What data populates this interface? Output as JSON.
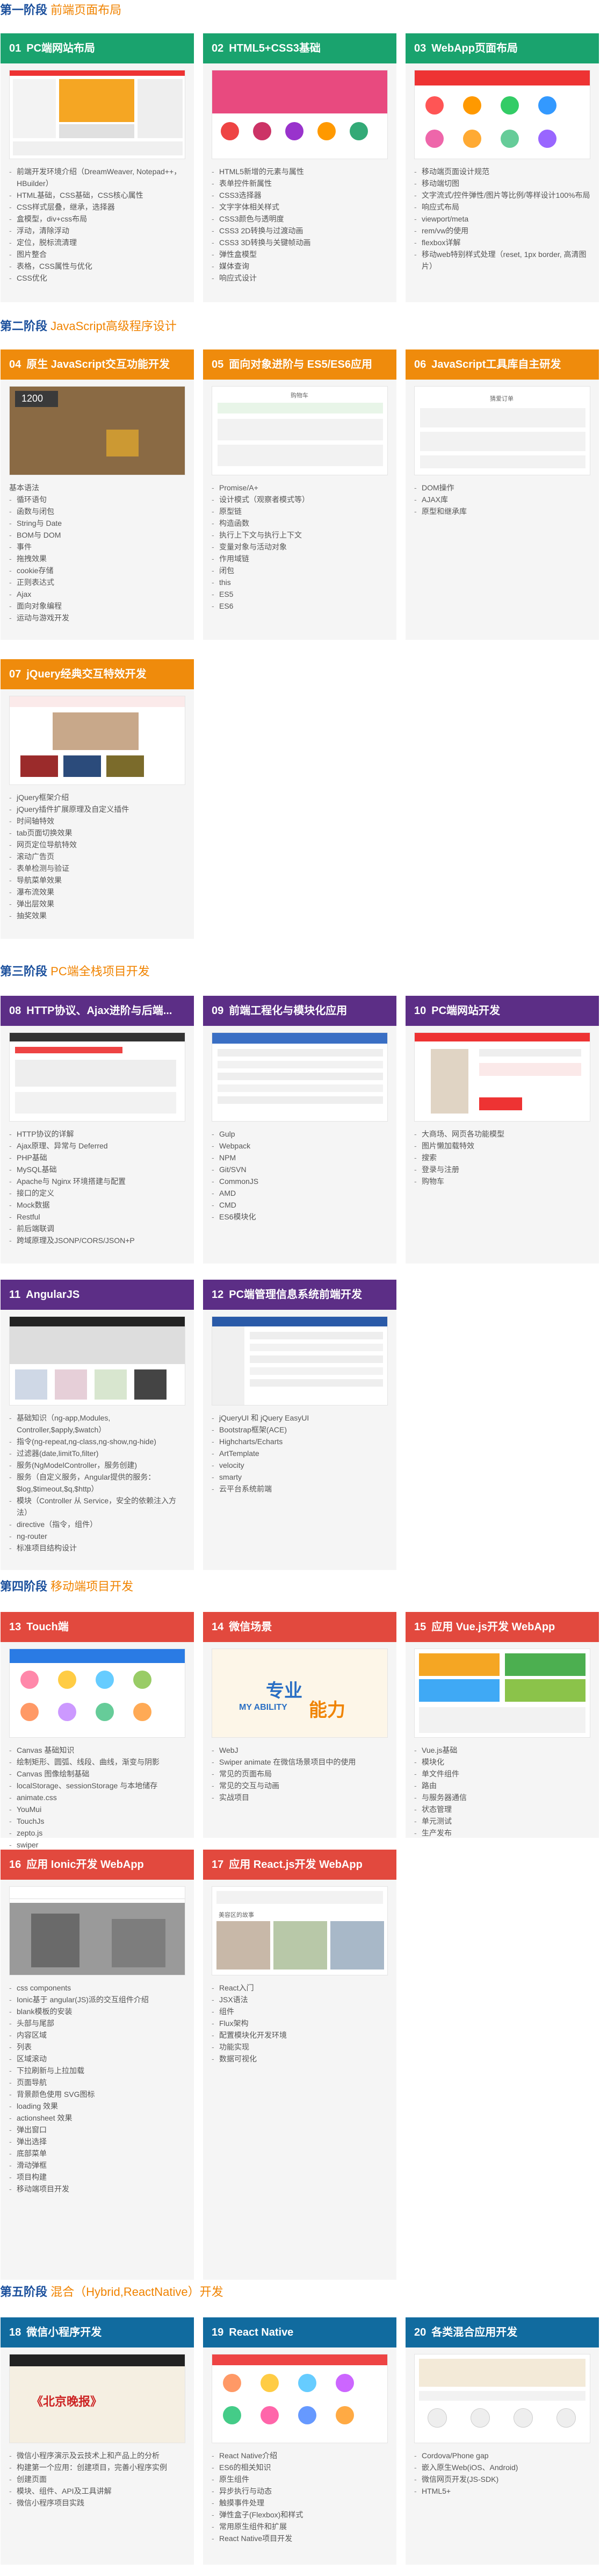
{
  "stages": [
    {
      "bold": "第一阶段",
      "sub": "前端页面布局"
    },
    {
      "bold": "第二阶段",
      "sub": "JavaScript高级程序设计"
    },
    {
      "bold": "第三阶段",
      "sub": "PC端全栈项目开发"
    },
    {
      "bold": "第四阶段",
      "sub": "移动端项目开发"
    },
    {
      "bold": "第五阶段",
      "sub": "混合（Hybrid,ReactNative）开发"
    }
  ],
  "cards": [
    {
      "num": "01",
      "title": "PC端网站布局",
      "items": [
        "前端开发环境介绍（DreamWeaver, Notepad++，HBuilder）",
        "HTML基础，CSS基础，CSS核心属性",
        "CSS样式层叠，继承，选择器",
        "盒模型，div+css布局",
        "浮动，清除浮动",
        "定位，脱标流清理",
        "图片整合",
        "表格，CSS属性与优化",
        "CSS优化"
      ]
    },
    {
      "num": "02",
      "title": "HTML5+CSS3基础",
      "items": [
        "HTML5新增的元素与属性",
        "表单控件新属性",
        "CSS3选择器",
        "文字字体相关样式",
        "CSS3颜色与透明度",
        "CSS3 2D转换与过渡动画",
        "CSS3 3D转换与关键帧动画",
        "弹性盒模型",
        "媒体查询",
        "响应式设计"
      ]
    },
    {
      "num": "03",
      "title": "WebApp页面布局",
      "items": [
        "移动端页面设计规范",
        "移动端切图",
        "文字流式/控件弹性/图片等比例/等样设计100%布局",
        "响应式布局",
        "viewport/meta",
        "rem/vw的使用",
        "flexbox详解",
        "移动web特别样式处理（reset, 1px border, 高清图片）"
      ]
    },
    {
      "num": "04",
      "title": "原生 JavaScript交互功能开发",
      "items": [
        "基本语法",
        "循环语句",
        "函数与闭包",
        "String与 Date",
        "BOM与 DOM",
        "事件",
        "拖拽效果",
        "cookie存储",
        "正则表达式",
        "Ajax",
        "面向对象编程",
        "运动与游戏开发"
      ]
    },
    {
      "num": "05",
      "title": "面向对象进阶与 ES5/ES6应用",
      "items": [
        "Promise/A+",
        "设计模式（观察者模式等）",
        "原型链",
        "构造函数",
        "执行上下文与执行上下文",
        "变量对象与活动对象",
        "作用域链",
        "闭包",
        "this",
        "ES5",
        "ES6"
      ]
    },
    {
      "num": "06",
      "title": "JavaScript工具库自主研发",
      "items": [
        "DOM操作",
        "AJAX库",
        "原型和继承库"
      ]
    },
    {
      "num": "07",
      "title": "jQuery经典交互特效开发",
      "items": [
        "jQuery框架介绍",
        "jQuery插件扩展原理及自定义插件",
        "时间轴特效",
        "tab页面切换效果",
        "网页定位导航特效",
        "滚动广告页",
        "表单检测与验证",
        "导航菜单效果",
        "瀑布流效果",
        "弹出层效果",
        "抽奖效果"
      ]
    },
    {
      "num": "08",
      "title": "HTTP协议、Ajax进阶与后端...",
      "items": [
        "HTTP协议的详解",
        "Ajax原理、异常与 Deferred",
        "PHP基础",
        "MySQL基础",
        "Apache与 Nginx 环境搭建与配置",
        "接口的定义",
        "Mock数据",
        "Restful",
        "前后端联调",
        "跨域原理及JSONP/CORS/JSON+P"
      ]
    },
    {
      "num": "09",
      "title": "前端工程化与模块化应用",
      "items": [
        "Gulp",
        "Webpack",
        "NPM",
        "Git/SVN",
        "CommonJS",
        "AMD",
        "CMD",
        "ES6模块化"
      ]
    },
    {
      "num": "10",
      "title": "PC端网站开发",
      "items": [
        "大商场、网页各功能模型",
        "图片懒加载特效",
        "搜索",
        "登录与注册",
        "购物车"
      ]
    },
    {
      "num": "11",
      "title": "AngularJS",
      "items": [
        "基础知识（ng-app,Modules, Controller,$apply,$watch）",
        "指令(ng-repeat,ng-class,ng-show,ng-hide)",
        "过滤器(date,limitTo,filter)",
        "服务(NgModelController，服务创建)",
        "服务（自定义服务，Angular提供的服务：$log,$timeout,$q,$http）",
        "模块（Controller 从 Service，安全的依赖注入方法）",
        "directive（指令，组件）",
        "ng-router",
        "标准项目结构设计"
      ]
    },
    {
      "num": "12",
      "title": "PC端管理信息系统前端开发",
      "items": [
        "jQueryUI 和 jQuery EasyUI",
        "Bootstrap框架(ACE)",
        "Highcharts/Echarts",
        "ArtTemplate",
        "velocity",
        "smarty",
        "云平台系统前端"
      ]
    },
    {
      "num": "13",
      "title": "Touch端",
      "items": [
        "Canvas 基础知识",
        "绘制矩形、圆弧、线段、曲线，渐变与阴影",
        "Canvas 图像绘制基础",
        "localStorage、sessionStorage 与本地储存",
        "animate.css",
        "YouMui",
        "TouchJs",
        "zepto.js",
        "swiper",
        "iScroll"
      ]
    },
    {
      "num": "14",
      "title": "微信场景",
      "items": [
        "WebJ",
        "Swiper animate 在微信场景项目中的使用",
        "常见的页面布局",
        "常见的交互与动画",
        "实战项目"
      ]
    },
    {
      "num": "15",
      "title": "应用 Vue.js开发 WebApp",
      "items": [
        "Vue.js基础",
        "模块化",
        "单文件组件",
        "路由",
        "与服务器通信",
        "状态管理",
        "单元测试",
        "生产发布"
      ]
    },
    {
      "num": "16",
      "title": "应用 Ionic开发 WebApp",
      "items": [
        "css components",
        "Ionic基于 angular(JS)派的交互组件介绍",
        "blank模板的安装",
        "头部与尾部",
        "内容区域",
        "列表",
        "区域滚动",
        "下拉刷新与上拉加载",
        "页面导航",
        "背景颜色使用 SVG图标",
        "loading 效果",
        "actionsheet 效果",
        "弹出窗口",
        "弹出选择",
        "底部菜单",
        "滑动弹框",
        "项目构建",
        "移动端项目开发"
      ]
    },
    {
      "num": "17",
      "title": "应用 React.js开发 WebApp",
      "items": [
        "React入门",
        "JSX语法",
        "组件",
        "Flux架构",
        "配置模块化开发环境",
        "功能实现",
        "数据可视化"
      ]
    },
    {
      "num": "18",
      "title": "微信小程序开发",
      "items": [
        "微信小程序演示及云技术上和产品上的分析",
        "构建第一个应用：创建项目，完善小程序实例",
        "创建页面",
        "模块、组件、API及工具讲解",
        "微信小程序项目实践"
      ]
    },
    {
      "num": "19",
      "title": "React Native",
      "items": [
        "React Native介绍",
        "ES6的相关知识",
        "原生组件",
        "异步执行与动态",
        "触摸事件处理",
        "弹性盒子(Flexbox)和样式",
        "常用原生组件和扩展",
        "React Native项目开发"
      ]
    },
    {
      "num": "20",
      "title": "各类混合应用开发",
      "items": [
        "Cordova/Phone gap",
        "嵌入原生Web(iOS、Android)",
        "微信网页开发(JS-SDK)",
        "HTML5+"
      ]
    }
  ],
  "shot_text": {
    "c04_score": "1200",
    "c05_title": "购物车",
    "c06_title": "猜爱订单",
    "c14_title": "专业",
    "c14_title2": "能力",
    "c14_sub": "MY ABILITY",
    "c18_banner": "《北京晚报》",
    "c17_caption": "美容区的故事"
  },
  "colors": {
    "title_blue": "#1a4f9c",
    "subtitle_orange": "#f08300",
    "stage1": "#1aa36e",
    "stage2": "#ef8b0c",
    "stage3": "#5c2e86",
    "stage4": "#e2493e",
    "stage5": "#116b9f"
  }
}
